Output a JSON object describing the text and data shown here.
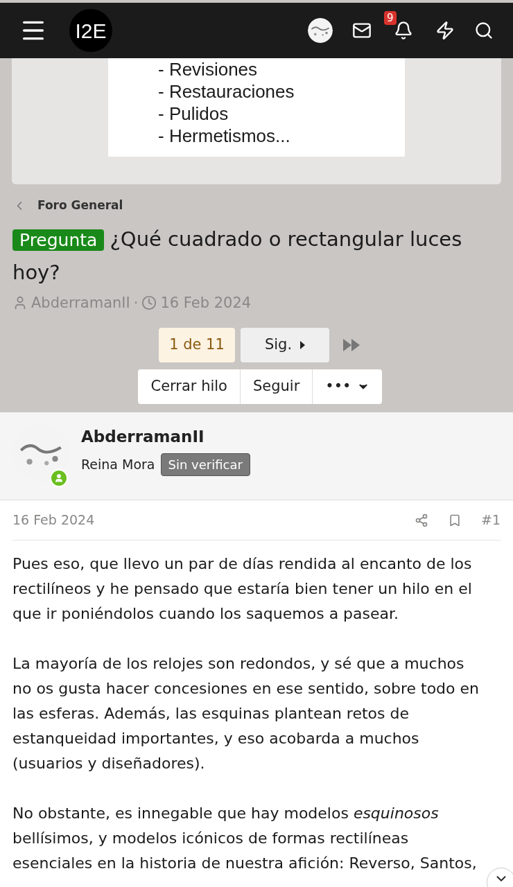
{
  "header": {
    "logo": "I2E",
    "notifications_badge": "9"
  },
  "banner": {
    "lines": [
      "- Revisiones",
      "- Restauraciones",
      "- Pulidos",
      "- Hermetismos..."
    ]
  },
  "breadcrumb": "Foro General",
  "thread": {
    "prefix": "Pregunta",
    "title": "¿Qué cuadrado o rectangular luces hoy?",
    "author": "AbderramanII",
    "separator": "·",
    "date": "16 Feb 2024"
  },
  "pagination": {
    "current": "1 de 11",
    "next": "Sig."
  },
  "actions": [
    "Cerrar hilo",
    "Seguir",
    "•••"
  ],
  "post": {
    "author": "AbderramanII",
    "title": "Reina Mora",
    "badge": "Sin verificar",
    "online": true,
    "date": "16 Feb 2024",
    "number": "#1",
    "paragraphs": [
      "Pues eso, que llevo un par de días rendida al encanto de los rectilíneos y he pensado que estaría bien tener un hilo en el que ir poniéndolos cuando los saquemos a pasear.",
      "La mayoría de los relojes son redondos, y sé que a muchos no os gusta hacer concesiones en ese sentido, sobre todo en las esferas. Además, las esquinas plantean retos de estanqueidad importantes, y eso acobarda a muchos (usuarios y diseñadores).",
      "No obstante, es innegable que hay modelos *esquinosos* bellísimos, y modelos icónicos de formas rectilíneas esenciales en la historia de nuestra afición: Reverso, Santos,"
    ]
  }
}
